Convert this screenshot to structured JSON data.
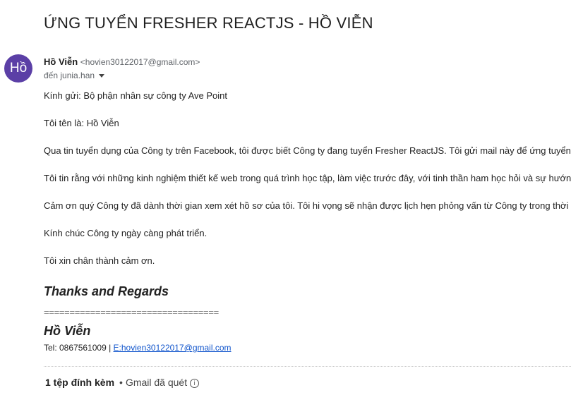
{
  "subject": "ỨNG TUYỂN FRESHER REACTJS - HỒ VIỄN",
  "sender": {
    "avatar_text": "Hồ",
    "name": "Hồ Viễn",
    "email": "<hovien30122017@gmail.com>",
    "to": "đến junia.han",
    "avatar_color": "#5b3fa6"
  },
  "body": {
    "p1": "Kính gửi: Bộ phận nhân sự công ty  Ave Point",
    "p2": "Tôi tên là: Hồ Viễn",
    "p3": "Qua tin tuyển dụng của Công ty trên Facebook, tôi được biết Công ty đang tuyển Fresher ReactJS. Tôi gửi mail này để ứng tuyển",
    "p4": "Tôi tin rằng với những kinh nghiệm thiết kế web trong quá trình học tập, làm việc trước đây, với tinh thần ham học hỏi và sự hướn",
    "p5": "Cảm ơn quý Công ty đã dành thời gian xem xét hồ sơ của tôi. Tôi hi vọng sẽ nhận được lịch hẹn phỏng vấn từ Công ty trong thời",
    "p6": "Kính chúc Công ty ngày càng phát triển.",
    "p7": "Tôi xin chân thành cảm ơn."
  },
  "signature": {
    "regards": "Thanks and Regards",
    "rule": "==================================",
    "name": "Hồ Viễn",
    "phone": "Tel: 0867561009 |",
    "email_link": "E:hovien30122017@gmail.com"
  },
  "attachments": {
    "count_label": "1 tệp đính kèm",
    "scan_label": "Gmail đã quét",
    "info_icon": "info-icon"
  }
}
